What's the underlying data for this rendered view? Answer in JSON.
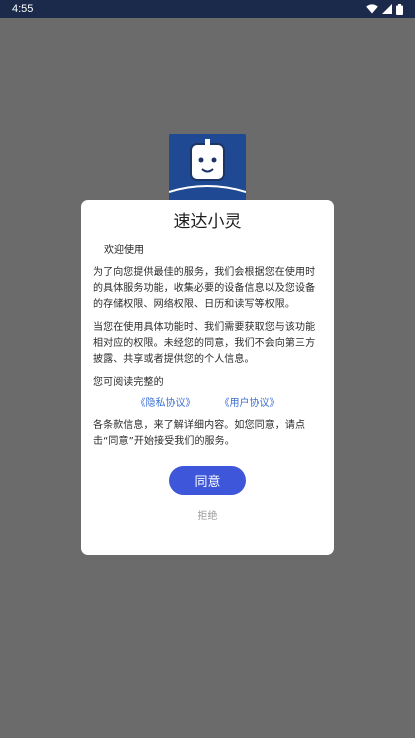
{
  "status_bar": {
    "time": "4:55",
    "icons": [
      "wifi-icon",
      "signal-icon",
      "battery-icon"
    ],
    "background": "#1b2a4b"
  },
  "splash": {
    "logo_icon": "robot-socket-logo",
    "logo_color": "#1f4a93",
    "background": "#6b6b6b"
  },
  "dialog": {
    "title": "速达小灵",
    "welcome": "欢迎使用",
    "para1": "为了向您提供最佳的服务，我们会根据您在使用时的具体服务功能，收集必要的设备信息以及您设备的存储权限、网络权限、日历和读写等权限。",
    "para2": "当您在使用具体功能时、我们需要获取您与该功能相对应的权限。未经您的同意，我们不会向第三方披露、共享或者提供您的个人信息。",
    "para3": "您可阅读完整的",
    "privacy_link": "《隐私协议》",
    "user_link": "《用户协议》",
    "para4": "各条款信息，来了解详细内容。如您同意，请点击“同意”开始接受我们的服务。",
    "agree_label": "同意",
    "reject_label": "拒绝",
    "accent_color": "#3e56d9",
    "link_color": "#3d6fd6"
  }
}
